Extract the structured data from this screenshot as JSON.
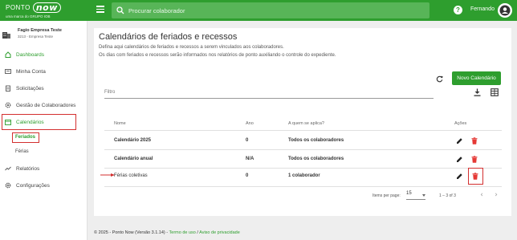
{
  "header": {
    "logo_text": "PONTO",
    "logo_now": "now",
    "logo_sub": "uma marca do GRUPO IOB",
    "search_placeholder": "Procurar colaborador",
    "user_name": "Fernando",
    "colors": {
      "brand": "#2e9e2e",
      "search_bg": "#58b558"
    }
  },
  "sidebar": {
    "company_name": "Fagio Empresa Teste",
    "company_sub": "3213 - Empresa Teste",
    "items": [
      {
        "label": "Dashboards",
        "icon": "home-icon"
      },
      {
        "label": "Minha Conta",
        "icon": "card-icon"
      },
      {
        "label": "Solicitações",
        "icon": "clipboard-icon"
      },
      {
        "label": "Gestão de Colaboradores",
        "icon": "gear-icon"
      },
      {
        "label": "Calendários",
        "icon": "calendar-icon"
      },
      {
        "label": "Relatórios",
        "icon": "chart-icon"
      },
      {
        "label": "Configurações",
        "icon": "settings-icon"
      }
    ],
    "subitems": [
      {
        "label": "Feriados"
      },
      {
        "label": "Férias"
      }
    ],
    "active_color": "#2e9e2e",
    "highlight_color": "#d32f2f"
  },
  "main": {
    "title": "Calendários de feriados e recessos",
    "description_1": "Defina aqui calendários de feriados e recessos a serem vinculados aos colaboradores.",
    "description_2": "Os dias com feriados e recessos serão informados nos relatórios de ponto auxiliando o controle do expediente.",
    "new_button": "Novo Calendário",
    "filter_label": "Filtro",
    "columns": [
      "Nome",
      "Ano",
      "A quem se aplica?",
      "Ações"
    ],
    "rows": [
      {
        "name": "Calendário 2025",
        "year": "0",
        "applies": "Todos os colaboradores"
      },
      {
        "name": "Calendário anual",
        "year": "N/A",
        "applies": "Todos os colaboradores"
      },
      {
        "name": "Férias coletivas",
        "year": "0",
        "applies": "1 colaborador"
      }
    ],
    "pagination": {
      "items_per_page_label": "Items per page:",
      "items_per_page": "15",
      "range": "1 – 3 of 3"
    }
  },
  "footer": {
    "text": "© 2025 - Ponto Now (Versão 3.1.14) - ",
    "terms": "Termo de uso",
    "sep": " / ",
    "privacy": "Aviso de privacidade"
  }
}
